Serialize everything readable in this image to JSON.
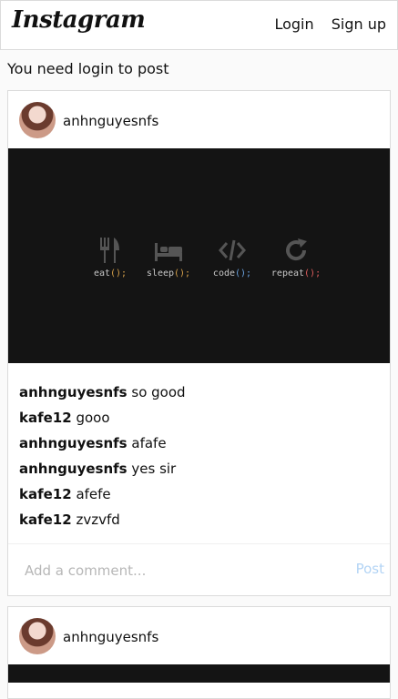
{
  "header": {
    "logo": "Instagram",
    "login": "Login",
    "signup": "Sign up"
  },
  "notice": "You need login to post",
  "posts": [
    {
      "username": "anhnguyesnfs",
      "image": {
        "items": [
          {
            "icon": "fork-knife-icon",
            "name": "eat",
            "paren": "();"
          },
          {
            "icon": "bed-icon",
            "name": "sleep",
            "paren": "();"
          },
          {
            "icon": "code-icon",
            "name": "code",
            "paren": "();"
          },
          {
            "icon": "repeat-icon",
            "name": "repeat",
            "paren": "();"
          }
        ]
      },
      "comments": [
        {
          "user": "anhnguyesnfs",
          "text": "so good"
        },
        {
          "user": "kafe12",
          "text": "gooo"
        },
        {
          "user": "anhnguyesnfs",
          "text": "afafe"
        },
        {
          "user": "anhnguyesnfs",
          "text": "yes sir"
        },
        {
          "user": "kafe12",
          "text": "afefe"
        },
        {
          "user": "kafe12",
          "text": "zvzvfd"
        }
      ],
      "comment_placeholder": "Add a comment...",
      "post_button": "Post"
    },
    {
      "username": "anhnguyesnfs"
    }
  ]
}
